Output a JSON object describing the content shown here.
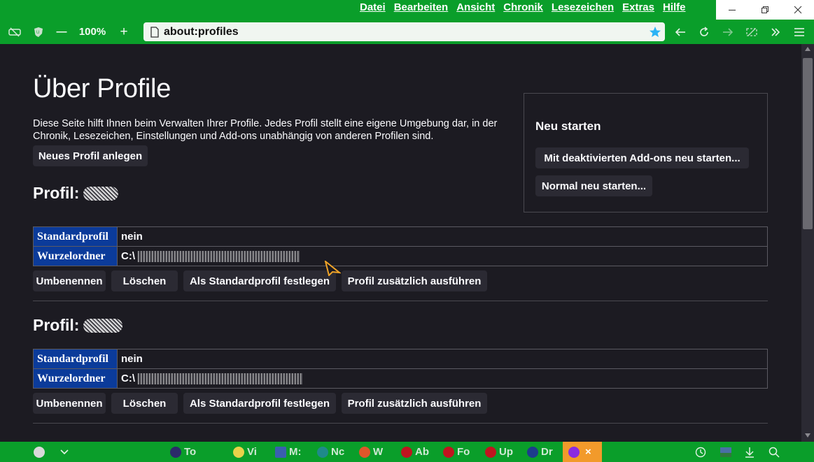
{
  "menubar": {
    "items": [
      "Datei",
      "Bearbeiten",
      "Ansicht",
      "Chronik",
      "Lesezeichen",
      "Extras",
      "Hilfe"
    ]
  },
  "toolbar": {
    "zoom_minus": "—",
    "zoom": "100%",
    "zoom_plus": "+",
    "url": "about:profiles"
  },
  "page": {
    "title": "Über Profile",
    "intro": "Diese Seite hilft Ihnen beim Verwalten Ihrer Profile. Jedes Profil stellt eine eigene Umgebung dar, in der Chronik, Lesezeichen, Einstellungen und Add-ons unabhängig von anderen Profilen sind.",
    "new_profile_button": "Neues Profil anlegen",
    "restart": {
      "heading": "Neu starten",
      "without_addons": "Mit deaktivierten Add-ons neu starten...",
      "normal": "Normal neu starten..."
    },
    "profiles": [
      {
        "heading": "Profil:",
        "default_label": "Standardprofil",
        "default_value": "nein",
        "root_label": "Wurzelordner",
        "root_prefix": "C:\\",
        "buttons": {
          "rename": "Umbenennen",
          "delete": "Löschen",
          "set_default": "Als Standardprofil festlegen",
          "launch": "Profil zusätzlich ausführen"
        }
      },
      {
        "heading": "Profil:",
        "default_label": "Standardprofil",
        "default_value": "nein",
        "root_label": "Wurzelordner",
        "root_prefix": "C:\\",
        "buttons": {
          "rename": "Umbenennen",
          "delete": "Löschen",
          "set_default": "Als Standardprofil festlegen",
          "launch": "Profil zusätzlich ausführen"
        }
      }
    ]
  },
  "taskbar": {
    "items": [
      {
        "label": "To",
        "icon": "globe-icon",
        "color": "#2b2b6a"
      },
      {
        "label": "Vi",
        "icon": "bulb-icon",
        "color": "#e8d24a"
      },
      {
        "label": "M:",
        "icon": "app-icon",
        "color": "#3a5fb0"
      },
      {
        "label": "Nc",
        "icon": "leaf-icon",
        "color": "#1f8a8a"
      },
      {
        "label": "W",
        "icon": "flower-icon",
        "color": "#e0562a"
      },
      {
        "label": "Ab",
        "icon": "flame-icon",
        "color": "#c0151f"
      },
      {
        "label": "Fo",
        "icon": "flame-icon",
        "color": "#c0151f"
      },
      {
        "label": "Up",
        "icon": "flame-icon",
        "color": "#c0151f"
      },
      {
        "label": "Dr",
        "icon": "compass-icon",
        "color": "#1d3c8c"
      }
    ],
    "active_close": "×"
  },
  "colors": {
    "chrome_green": "#0a9e2a",
    "page_bg": "#1c1b22",
    "table_key_bg": "#0b3b9a",
    "button_bg": "#2b2a33",
    "star": "#2bb3f5"
  }
}
